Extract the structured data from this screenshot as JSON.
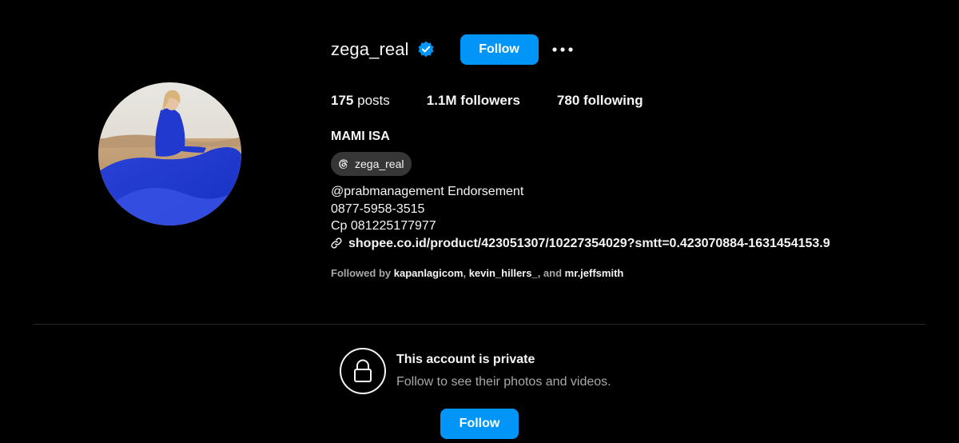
{
  "profile": {
    "username": "zega_real",
    "verified": true,
    "follow_label": "Follow",
    "more_label": "•••",
    "avatar_description": "avatar photo"
  },
  "stats": {
    "posts_count": "175",
    "posts_label": "posts",
    "followers_count": "1.1M",
    "followers_label": "followers",
    "following_count": "780",
    "following_label": "following"
  },
  "bio": {
    "full_name": "MAMI ISA",
    "threads_handle": "zega_real",
    "lines": [
      "@prabmanagement Endorsement",
      "0877-5958-3515",
      "Cp 081225177977"
    ],
    "link": "shopee.co.id/product/423051307/10227354029?smtt=0.423070884-1631454153.9"
  },
  "followed_by": {
    "prefix": "Followed by",
    "accounts": [
      "kapanlagicom",
      "kevin_hillers_",
      "mr.jeffsmith"
    ],
    "sep": ",",
    "and": ", and"
  },
  "private": {
    "title": "This account is private",
    "subtitle": "Follow to see their photos and videos.",
    "follow_label": "Follow"
  },
  "colors": {
    "background": "#000000",
    "accent": "#0095f6",
    "pill": "#363636",
    "muted": "#a8a8a8",
    "divider": "#262626"
  },
  "icons": [
    "verified-badge-icon",
    "more-options-icon",
    "threads-icon",
    "link-icon",
    "lock-icon"
  ]
}
